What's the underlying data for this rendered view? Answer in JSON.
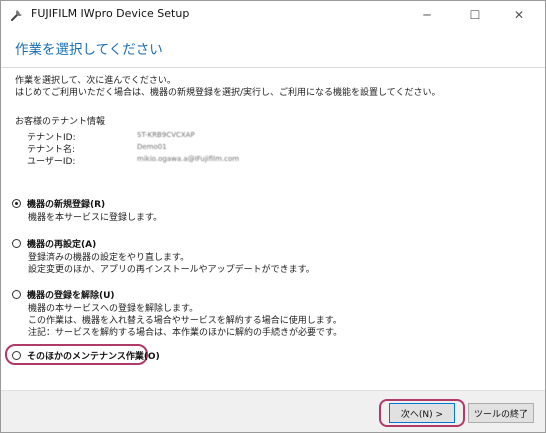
{
  "window": {
    "title": "FUJIFILM IWpro Device Setup",
    "minimize_label": "─",
    "maximize_label": "☐",
    "close_label": "✕"
  },
  "header": {
    "title": "作業を選択してください"
  },
  "intro": {
    "line1": "作業を選択して、次に進んでください。",
    "line2": "はじめてご利用いただく場合は、機器の新規登録を選択/実行し、ご利用になる機能を設置してください。"
  },
  "tenant": {
    "heading": "お客様のテナント情報",
    "id_label": "テナントID:",
    "id_value": "ST-KRB9CVCXAP",
    "name_label": "テナント名:",
    "name_value": "Demo01",
    "user_label": "ユーザーID:",
    "user_value": "mikio.ogawa.a@IFujifilm.com"
  },
  "options": [
    {
      "label": "機器の新規登録(R)",
      "checked": true,
      "desc": [
        "機器を本サービスに登録します。"
      ]
    },
    {
      "label": "機器の再設定(A)",
      "checked": false,
      "desc": [
        "登録済みの機器の設定をやり直します。",
        "設定変更のほか、アプリの再インストールやアップデートができます。"
      ]
    },
    {
      "label": "機器の登録を解除(U)",
      "checked": false,
      "desc": [
        "機器の本サービスへの登録を解除します。",
        "この作業は、機器を入れ替える場合やサービスを解約する場合に使用します。",
        "注記：サービスを解約する場合は、本作業のほかに解約の手続きが必要です。"
      ]
    },
    {
      "label": "そのほかのメンテナンス作業(O)",
      "checked": false,
      "desc": []
    }
  ],
  "footer": {
    "next_label": "次へ(N) >",
    "quit_label": "ツールの終了"
  },
  "colors": {
    "header_title": "#1a6fb5",
    "highlight": "#b03a6a",
    "button_focus": "#0078d7"
  }
}
